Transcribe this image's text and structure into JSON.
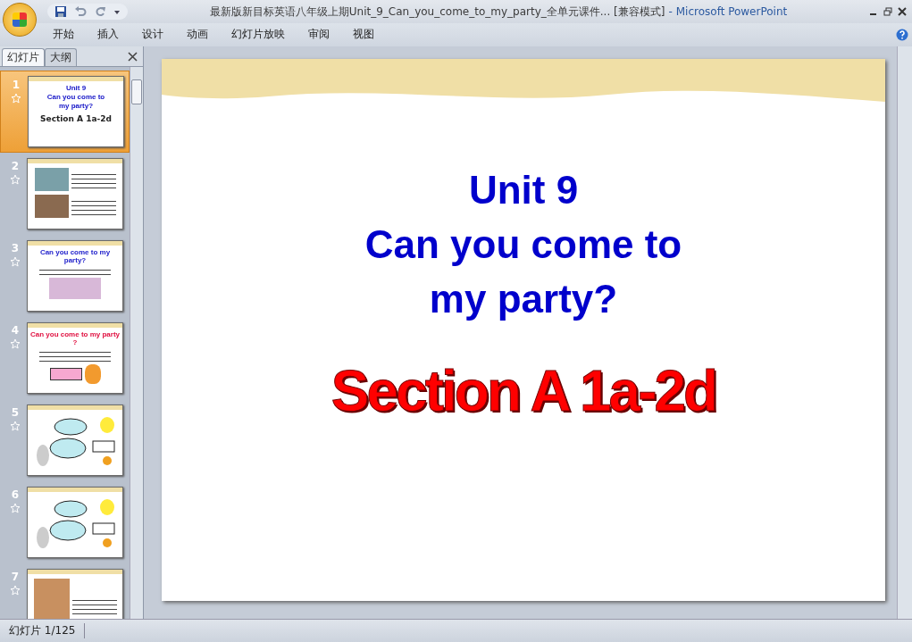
{
  "window": {
    "title": "最新版新目标英语八年级上期Unit_9_Can_you_come_to_my_party_全单元课件... [兼容模式]",
    "separator": "-",
    "app_name": "Microsoft PowerPoint"
  },
  "ribbon_tabs": [
    {
      "label": "开始",
      "selected": false
    },
    {
      "label": "插入",
      "selected": false
    },
    {
      "label": "设计",
      "selected": false
    },
    {
      "label": "动画",
      "selected": false
    },
    {
      "label": "幻灯片放映",
      "selected": false
    },
    {
      "label": "审阅",
      "selected": false
    },
    {
      "label": "视图",
      "selected": false
    }
  ],
  "pane_tabs": [
    {
      "label": "幻灯片",
      "selected": true
    },
    {
      "label": "大纲",
      "selected": false
    }
  ],
  "slides": [
    {
      "number": "1",
      "selected": true,
      "kind": "title",
      "lines": [
        "Unit 9",
        "Can you come to",
        "my party?"
      ],
      "subtitle": "Section A 1a-2d"
    },
    {
      "number": "2",
      "selected": false,
      "kind": "photos"
    },
    {
      "number": "3",
      "selected": false,
      "kind": "photo",
      "heading": "Can you come to my party?"
    },
    {
      "number": "4",
      "selected": false,
      "kind": "list",
      "heading": "Can you come to my party ?"
    },
    {
      "number": "5",
      "selected": false,
      "kind": "cartoon"
    },
    {
      "number": "6",
      "selected": false,
      "kind": "cartoon"
    },
    {
      "number": "7",
      "selected": false,
      "kind": "comic"
    }
  ],
  "slide": {
    "title_lines": [
      "Unit 9",
      "Can you come to",
      "my party?"
    ],
    "subtitle": "Section A 1a-2d"
  },
  "status_bar": {
    "slide_counter": "幻灯片 1/125"
  }
}
